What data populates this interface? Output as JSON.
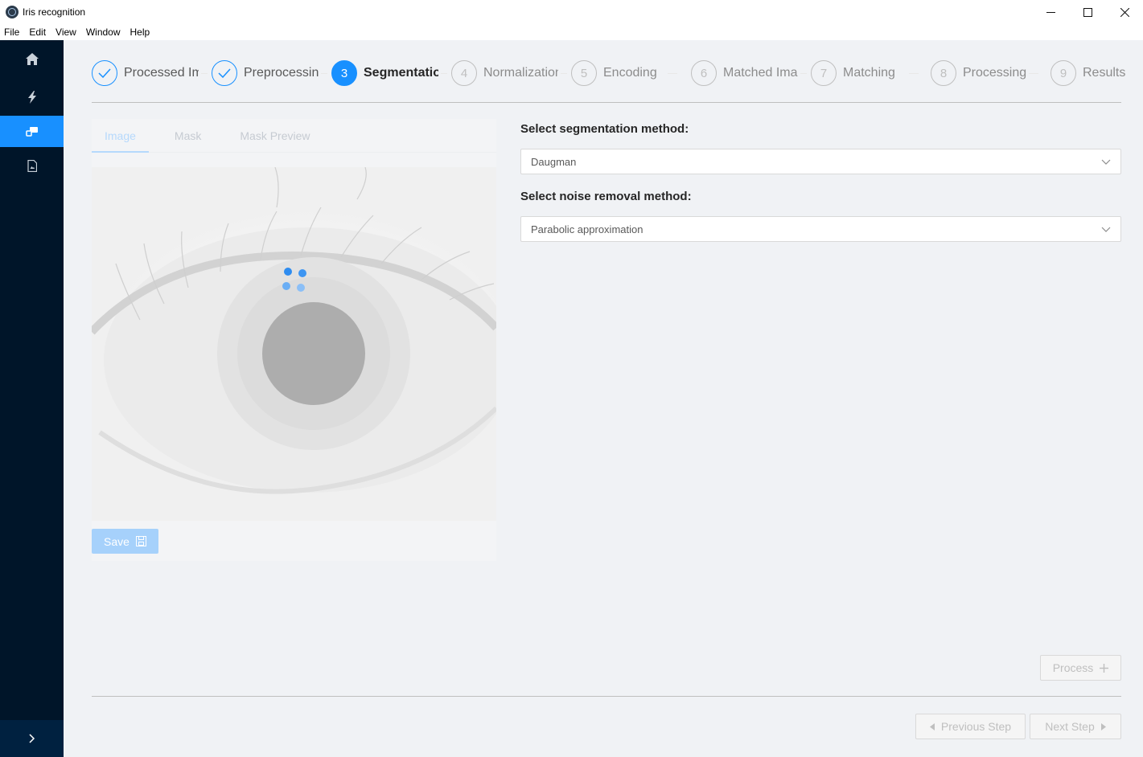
{
  "window": {
    "title": "Iris recognition",
    "controls": [
      "minimize-icon",
      "maximize-icon",
      "close-icon"
    ]
  },
  "menu": [
    "File",
    "Edit",
    "View",
    "Window",
    "Help"
  ],
  "sidebar": {
    "items": [
      {
        "icon": "home-icon",
        "active": false
      },
      {
        "icon": "lightning-icon",
        "active": false
      },
      {
        "icon": "segment-icon",
        "active": true
      },
      {
        "icon": "file-icon",
        "active": false
      }
    ],
    "collapse_icon": "chevron-right-icon"
  },
  "steps": [
    {
      "number": "1",
      "label": "Processed Im",
      "status": "done"
    },
    {
      "number": "2",
      "label": "Preprocessing",
      "status": "done"
    },
    {
      "number": "3",
      "label": "Segmentatio",
      "status": "active"
    },
    {
      "number": "4",
      "label": "Normalization",
      "status": "wait"
    },
    {
      "number": "5",
      "label": "Encoding",
      "status": "wait"
    },
    {
      "number": "6",
      "label": "Matched Ima",
      "status": "wait"
    },
    {
      "number": "7",
      "label": "Matching",
      "status": "wait"
    },
    {
      "number": "8",
      "label": "Processing",
      "status": "wait"
    },
    {
      "number": "9",
      "label": "Results",
      "status": "wait"
    }
  ],
  "image_card": {
    "tabs": [
      {
        "label": "Image",
        "active": true
      },
      {
        "label": "Mask",
        "active": false
      },
      {
        "label": "Mask Preview",
        "active": false
      }
    ],
    "loading": true,
    "save_label": "Save"
  },
  "form": {
    "segmentation_label": "Select segmentation method:",
    "segmentation_value": "Daugman",
    "noise_label": "Select noise removal method:",
    "noise_value": "Parabolic approximation"
  },
  "actions": {
    "process_label": "Process",
    "previous_label": "Previous Step",
    "next_label": "Next Step"
  },
  "colors": {
    "primary": "#1890ff",
    "sidebar": "#001529"
  }
}
